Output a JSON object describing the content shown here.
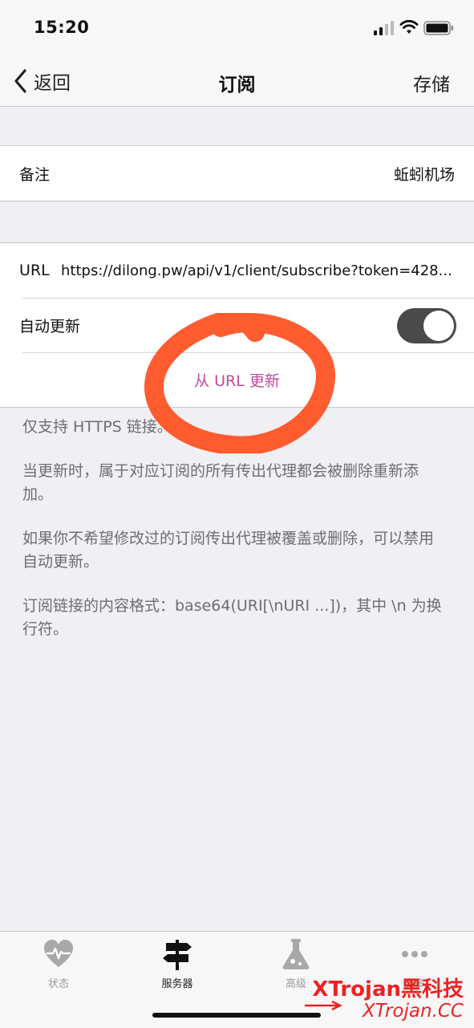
{
  "status_bar": {
    "time": "15:20"
  },
  "nav": {
    "back_label": "返回",
    "title": "订阅",
    "save_label": "存储"
  },
  "remark": {
    "label": "备注",
    "value": "蚯蚓机场"
  },
  "subscription": {
    "url_label": "URL",
    "url_value": "https://dilong.pw/api/v1/client/subscribe?token=428...",
    "auto_update_label": "自动更新",
    "auto_update_on": true,
    "update_action": "从 URL 更新"
  },
  "notes": [
    "仅支持 HTTPS 链接。",
    "当更新时，属于对应订阅的所有传出代理都会被删除重新添加。",
    "如果你不希望修改过的订阅传出代理被覆盖或删除，可以禁用自动更新。",
    "订阅链接的内容格式：base64(URI[\\nURI ...])，其中 \\n 为换行符。"
  ],
  "tabs": [
    {
      "label": "状态",
      "icon": "heart-pulse-icon",
      "active": false
    },
    {
      "label": "服务器",
      "icon": "signpost-icon",
      "active": true
    },
    {
      "label": "高级",
      "icon": "flask-icon",
      "active": false
    },
    {
      "label": "更多",
      "icon": "more-dots-icon",
      "active": false
    }
  ],
  "watermark": {
    "line1": "XTrojan黑科技",
    "line2": "XTrojan.CC"
  },
  "colors": {
    "accent": "#c0499e",
    "annotation": "#ff4a1a",
    "toggle_on": "#4a4a4a",
    "watermark": "#ee2222"
  }
}
